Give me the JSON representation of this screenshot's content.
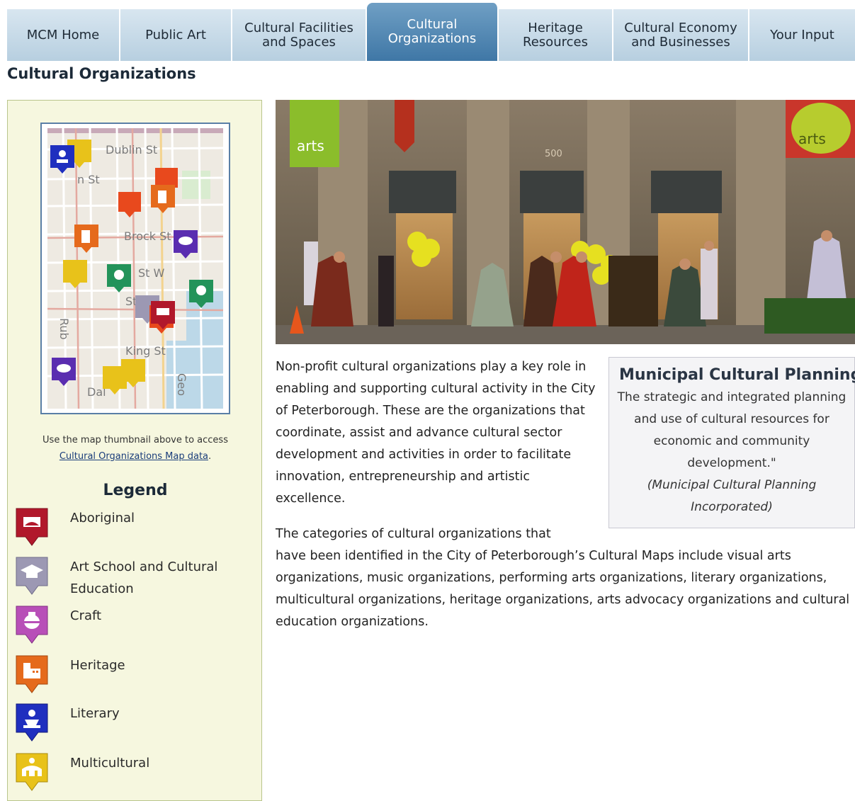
{
  "nav": {
    "tabs": [
      {
        "line1": "MCM Home",
        "line2": ""
      },
      {
        "line1": "Public Art",
        "line2": ""
      },
      {
        "line1": "Cultural Facilities",
        "line2": "and Spaces"
      },
      {
        "line1": "Cultural",
        "line2": "Organizations"
      },
      {
        "line1": "Heritage",
        "line2": "Resources"
      },
      {
        "line1": "Cultural Economy",
        "line2": "and Businesses"
      },
      {
        "line1": "Your Input",
        "line2": ""
      }
    ],
    "active_index": 3
  },
  "page": {
    "title": "Cultural Organizations"
  },
  "map": {
    "street_labels": [
      "Dublin St",
      "n St",
      "Brock St",
      "St W",
      "St",
      "King St",
      "Dal",
      "Geo",
      "Rub"
    ],
    "caption_prefix": "Use the map thumbnail above to access",
    "caption_link": "Cultural Organizations Map data",
    "caption_suffix": "."
  },
  "legend": {
    "title": "Legend",
    "items": [
      {
        "label": "Aboriginal",
        "color": "#b1182b",
        "icon": "aboriginal-icon"
      },
      {
        "label": "Art School and Cultural Education",
        "color": "#9c98b3",
        "icon": "graduation-cap-icon"
      },
      {
        "label": "Craft",
        "color": "#b84fb8",
        "icon": "pottery-icon"
      },
      {
        "label": "Heritage",
        "color": "#e56a1c",
        "icon": "historic-building-icon"
      },
      {
        "label": "Literary",
        "color": "#1f2fbf",
        "icon": "reader-icon"
      },
      {
        "label": "Multicultural",
        "color": "#e8c21a",
        "icon": "family-icon"
      }
    ]
  },
  "photo": {
    "banner_text": "arts",
    "building_number": "500"
  },
  "intro": {
    "text": "Non-profit cultural organizations play a key role in enabling and supporting cultural activity in the City of Peterborough. These are the organizations that coordinate, assist and advance cultural sector development and activities in order to facilitate innovation, entrepreneurship and artistic excellence."
  },
  "categories": {
    "first_line": "The categories of cultural organizations that",
    "rest": "have been identified in the City of Peterborough’s Cultural Maps include visual arts organizations, music organizations, performing arts organizations, literary organizations, multicultural organizations, heritage organizations, arts advocacy organizations and cultural education organizations."
  },
  "callout": {
    "title": "Municipal Cultural Planning",
    "body": "The strategic and integrated planning and use of cultural resources for economic and community development.\"",
    "source": "(Municipal Cultural Planning Incorporated)"
  },
  "colors": {
    "tab_active": "#4a82b0",
    "tab_inactive": "#c6d9e8",
    "panel_bg": "#f6f7df",
    "link": "#1a3d7a"
  }
}
